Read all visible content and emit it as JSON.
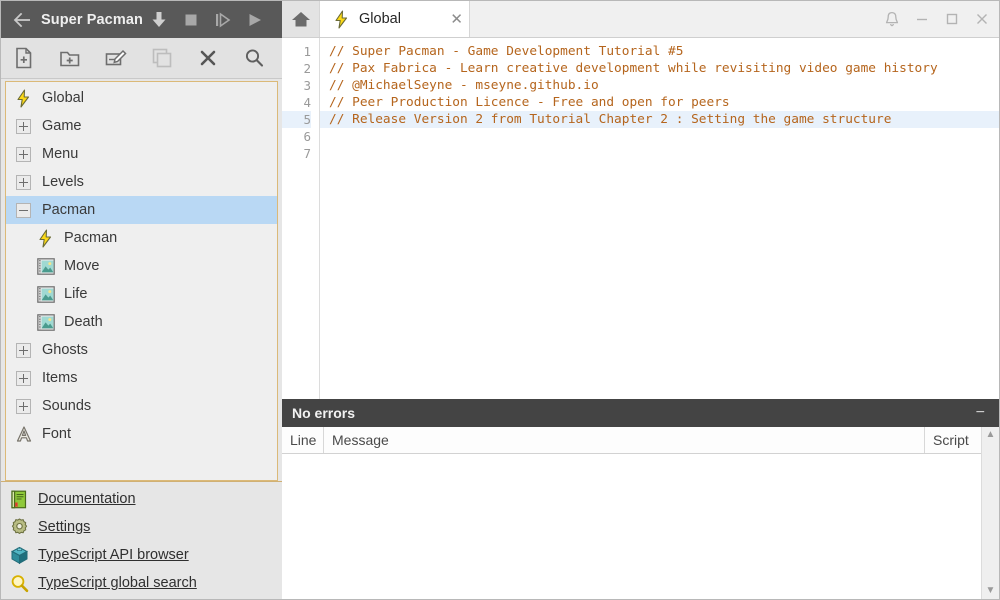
{
  "window": {
    "project_title": "Super Pacman",
    "back_icon": "back-arrow-icon",
    "actions": [
      {
        "name": "download-icon",
        "label": "Download"
      },
      {
        "name": "stop-icon",
        "label": "Stop"
      },
      {
        "name": "step-icon",
        "label": "Step"
      },
      {
        "name": "play-icon",
        "label": "Play"
      }
    ],
    "controls": [
      {
        "name": "bell-icon",
        "glyph": "␇"
      },
      {
        "name": "minimize-icon",
        "glyph": "—"
      },
      {
        "name": "maximize-icon",
        "glyph": "□"
      },
      {
        "name": "close-icon",
        "glyph": "✕"
      }
    ]
  },
  "toolbar": {
    "buttons": [
      {
        "name": "new-file-button",
        "label": "New file"
      },
      {
        "name": "new-folder-button",
        "label": "New folder"
      },
      {
        "name": "rename-button",
        "label": "Rename"
      },
      {
        "name": "duplicate-button",
        "label": "Duplicate"
      },
      {
        "name": "delete-button",
        "label": "Delete"
      },
      {
        "name": "search-button",
        "label": "Search"
      }
    ]
  },
  "tree": {
    "items": [
      {
        "label": "Global",
        "icon": "lightning-icon",
        "indent": 0,
        "selected": false,
        "expander": "none"
      },
      {
        "label": "Game",
        "icon": "expander-icon",
        "indent": 0,
        "selected": false,
        "expander": "plus"
      },
      {
        "label": "Menu",
        "icon": "expander-icon",
        "indent": 0,
        "selected": false,
        "expander": "plus"
      },
      {
        "label": "Levels",
        "icon": "expander-icon",
        "indent": 0,
        "selected": false,
        "expander": "plus"
      },
      {
        "label": "Pacman",
        "icon": "expander-icon",
        "indent": 0,
        "selected": true,
        "expander": "minus"
      },
      {
        "label": "Pacman",
        "icon": "lightning-icon",
        "indent": 1,
        "selected": false,
        "expander": "none"
      },
      {
        "label": "Move",
        "icon": "sprite-icon",
        "indent": 1,
        "selected": false,
        "expander": "none"
      },
      {
        "label": "Life",
        "icon": "sprite-icon",
        "indent": 1,
        "selected": false,
        "expander": "none"
      },
      {
        "label": "Death",
        "icon": "sprite-icon",
        "indent": 1,
        "selected": false,
        "expander": "none"
      },
      {
        "label": "Ghosts",
        "icon": "expander-icon",
        "indent": 0,
        "selected": false,
        "expander": "plus"
      },
      {
        "label": "Items",
        "icon": "expander-icon",
        "indent": 0,
        "selected": false,
        "expander": "plus"
      },
      {
        "label": "Sounds",
        "icon": "expander-icon",
        "indent": 0,
        "selected": false,
        "expander": "plus"
      },
      {
        "label": "Font",
        "icon": "font-icon",
        "indent": 0,
        "selected": false,
        "expander": "none"
      }
    ]
  },
  "links": [
    {
      "label": "Documentation",
      "icon": "book-icon"
    },
    {
      "label": "Settings",
      "icon": "gear-icon"
    },
    {
      "label": "TypeScript API browser",
      "icon": "cube-icon"
    },
    {
      "label": "TypeScript global search",
      "icon": "magnifier-icon"
    }
  ],
  "tabs": {
    "home_icon": "home-icon",
    "open": [
      {
        "label": "Global",
        "icon": "lightning-icon",
        "close_glyph": "✕",
        "active": true
      }
    ]
  },
  "editor": {
    "line_numbers": [
      "1",
      "2",
      "3",
      "4",
      "5",
      "6",
      "7"
    ],
    "current_line": 5,
    "lines": [
      "// Super Pacman - Game Development Tutorial #5",
      "// Pax Fabrica - Learn creative development while revisiting video game history",
      "// @MichaelSeyne - mseyne.github.io",
      "// Peer Production Licence - Free and open for peers",
      "// Release Version 2 from Tutorial Chapter 2 : Setting the game structure",
      "",
      ""
    ]
  },
  "errors": {
    "title": "No errors",
    "minimize_glyph": "−",
    "columns": [
      "Line",
      "Message",
      "Script"
    ],
    "rows": [],
    "scroll_up_glyph": "▲",
    "scroll_down_glyph": "▼"
  },
  "colors": {
    "titlebar_bg": "#595959",
    "accent_border": "#dbb978",
    "selection": "#b9d8f4",
    "comment": "#b5651d",
    "errorbar_bg": "#444444",
    "current_line": "#e8f1fb"
  }
}
